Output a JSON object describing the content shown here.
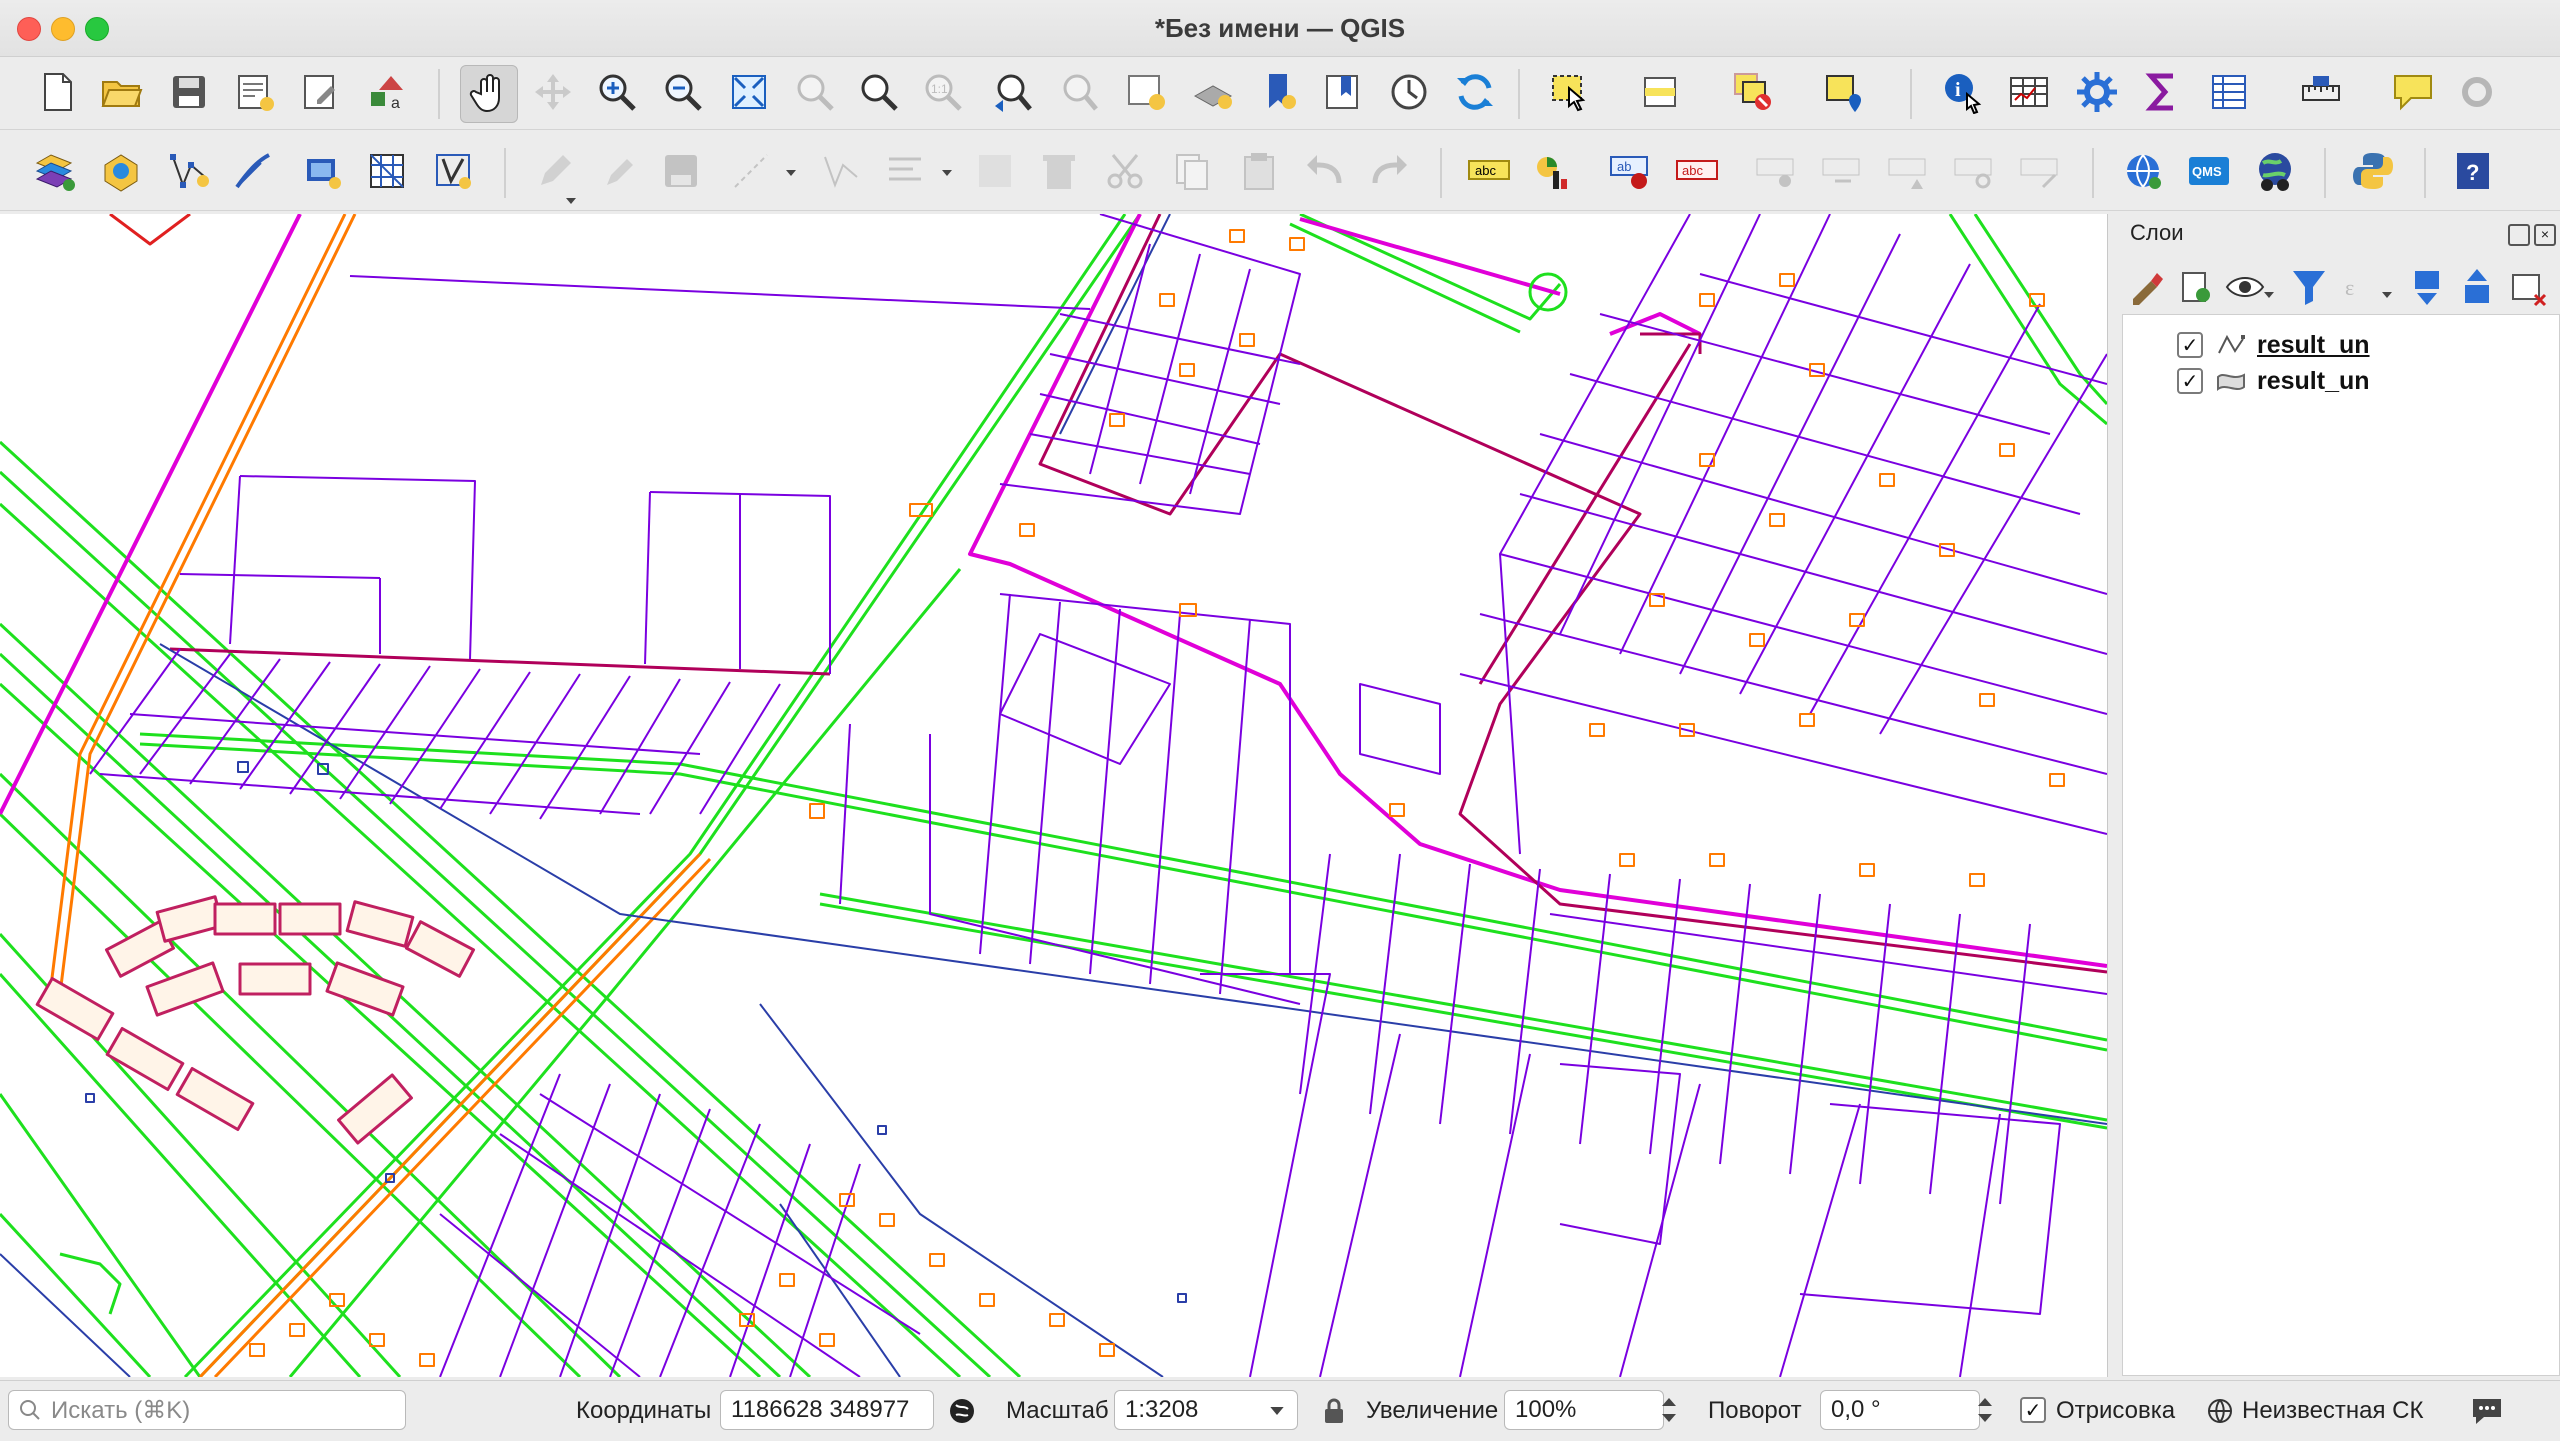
{
  "window": {
    "title": "*Без имени — QGIS"
  },
  "toolbar1": {
    "icons": [
      "new-project-icon",
      "open-project-icon",
      "save-project-icon",
      "new-print-layout-icon",
      "layout-manager-icon",
      "style-manager-icon",
      "pan-map-icon",
      "pan-to-selection-icon",
      "zoom-in-icon",
      "zoom-out-icon",
      "zoom-full-icon",
      "zoom-to-selection-icon",
      "zoom-to-layer-icon",
      "zoom-native-icon",
      "zoom-last-icon",
      "zoom-next-icon",
      "new-map-view-icon",
      "new-3d-view-icon",
      "new-bookmark-icon",
      "show-bookmarks-icon",
      "temporal-controller-icon",
      "refresh-icon",
      "select-features-icon",
      "select-by-attributes-icon",
      "deselect-icon",
      "select-by-location-icon",
      "identify-icon",
      "attribute-table-icon",
      "processing-toolbox-icon",
      "statistics-icon",
      "open-field-calculator-icon",
      "measure-icon",
      "map-tips-icon",
      "annotation-icon"
    ]
  },
  "toolbar2": {
    "icons": [
      "data-source-manager-icon",
      "new-geopackage-layer-icon",
      "digitize-vertex-icon",
      "digitize-pencil-icon",
      "add-wms-icon",
      "add-raster-icon",
      "add-virtual-layer-icon",
      "edit-pencil-icon",
      "toggle-editing-icon",
      "save-edits-icon",
      "add-feature-icon",
      "vertex-tool-icon",
      "modify-attributes-icon",
      "delete-selected-icon",
      "cut-icon",
      "copy-icon",
      "paste-icon",
      "undo-icon",
      "redo-icon",
      "label-tool-icon",
      "diagram-tool-icon",
      "pin-labels-icon",
      "highlight-labels-icon",
      "show-hide-labels-icon",
      "move-label-icon",
      "rotate-label-icon",
      "change-label-icon",
      "globe-plugin-icon",
      "qms-plugin-icon",
      "earth-plugin-icon",
      "python-console-icon",
      "help-icon"
    ],
    "qms_text": "QMS"
  },
  "layers_panel": {
    "title": "Слои",
    "layers": [
      {
        "name": "result_un",
        "checked": true,
        "geometry": "line",
        "active": true
      },
      {
        "name": "result_un",
        "checked": true,
        "geometry": "polygon",
        "active": false
      }
    ]
  },
  "status": {
    "search_placeholder": "Искать (⌘K)",
    "coordinates_label": "Координаты",
    "coordinates_value": "1186628  348977",
    "scale_label": "Масштаб",
    "scale_value": "1:3208",
    "magnifier_label": "Увеличение",
    "magnifier_value": "100%",
    "rotation_label": "Поворот",
    "rotation_value": "0,0 °",
    "render_label": "Отрисовка",
    "render_checked": true,
    "crs_label": "Неизвестная СК"
  },
  "map_colors": {
    "purple": "#7a00e0",
    "magenta": "#e000d8",
    "green": "#1ee01e",
    "orange": "#ff7a00",
    "navy": "#2a3ea8",
    "crimson": "#b0005a"
  }
}
